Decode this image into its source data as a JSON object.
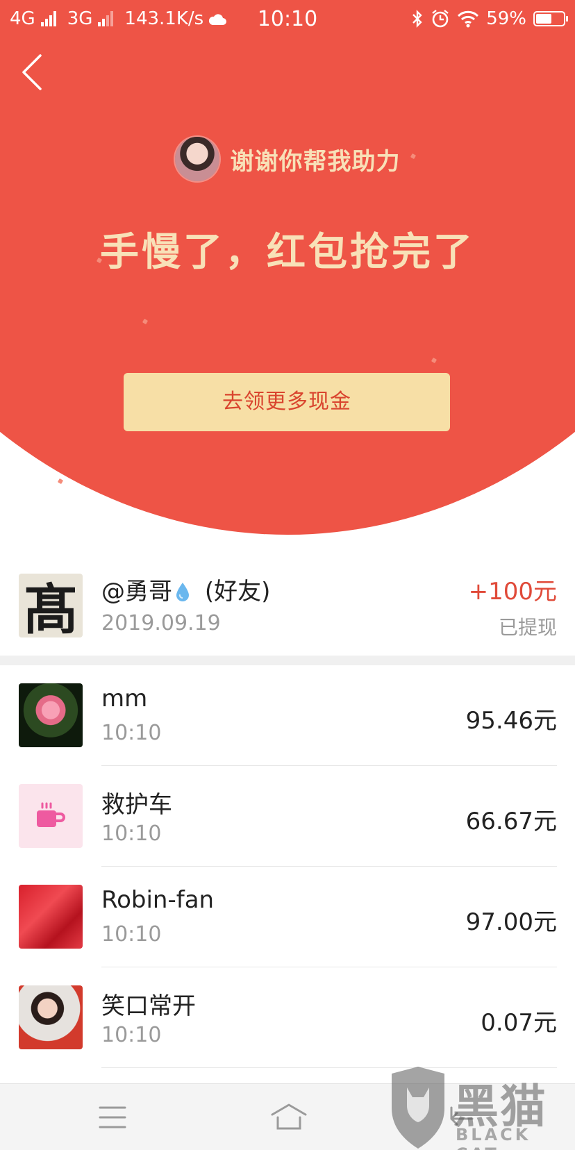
{
  "status_bar": {
    "network1": "4G",
    "network2": "3G",
    "speed": "143.1K/s",
    "time": "10:10",
    "battery": "59%"
  },
  "header": {
    "helper_text": "谢谢你帮我助力",
    "headline": "手慢了，红包抢完了",
    "cta_label": "去领更多现金"
  },
  "featured": {
    "name": "@勇哥",
    "tag": "(好友)",
    "date": "2019.09.19",
    "amount": "+100元",
    "status": "已提现",
    "avatar_char": "髙"
  },
  "list": [
    {
      "name": "mm",
      "time": "10:10",
      "amount": "95.46元"
    },
    {
      "name": "救护车",
      "time": "10:10",
      "amount": "66.67元"
    },
    {
      "name": "Robin-fan",
      "time": "10:10",
      "amount": "97.00元"
    },
    {
      "name": "笑口常开",
      "time": "10:10",
      "amount": "0.07元"
    }
  ],
  "watermark": {
    "cn": "黑猫",
    "en": "BLACK CAT"
  },
  "colors": {
    "header_red": "#ee5446",
    "gold_text": "#f8e1b8",
    "button_bg": "#f7dfa6",
    "button_text": "#d9442e",
    "amount_red": "#e04a39"
  }
}
